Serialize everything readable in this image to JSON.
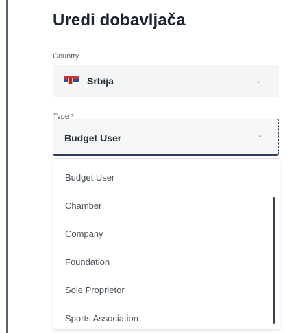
{
  "page": {
    "title": "Uredi dobavljača"
  },
  "country": {
    "label": "Country",
    "value": "Srbija",
    "flag_icon": "serbia-flag-icon",
    "chevron_icon": "chevron-down-icon"
  },
  "type": {
    "label": "Type *",
    "value": "Budget User",
    "chevron_icon": "chevron-up-icon",
    "options": [
      {
        "label": "Budget User"
      },
      {
        "label": "Chamber"
      },
      {
        "label": "Company"
      },
      {
        "label": "Foundation"
      },
      {
        "label": "Sole Proprietor"
      },
      {
        "label": "Sports Association"
      }
    ]
  },
  "colors": {
    "title": "#1b2230",
    "field_bg": "#f4f5f7",
    "focus_border": "#2c3e5a",
    "option_text": "#4a505a"
  }
}
